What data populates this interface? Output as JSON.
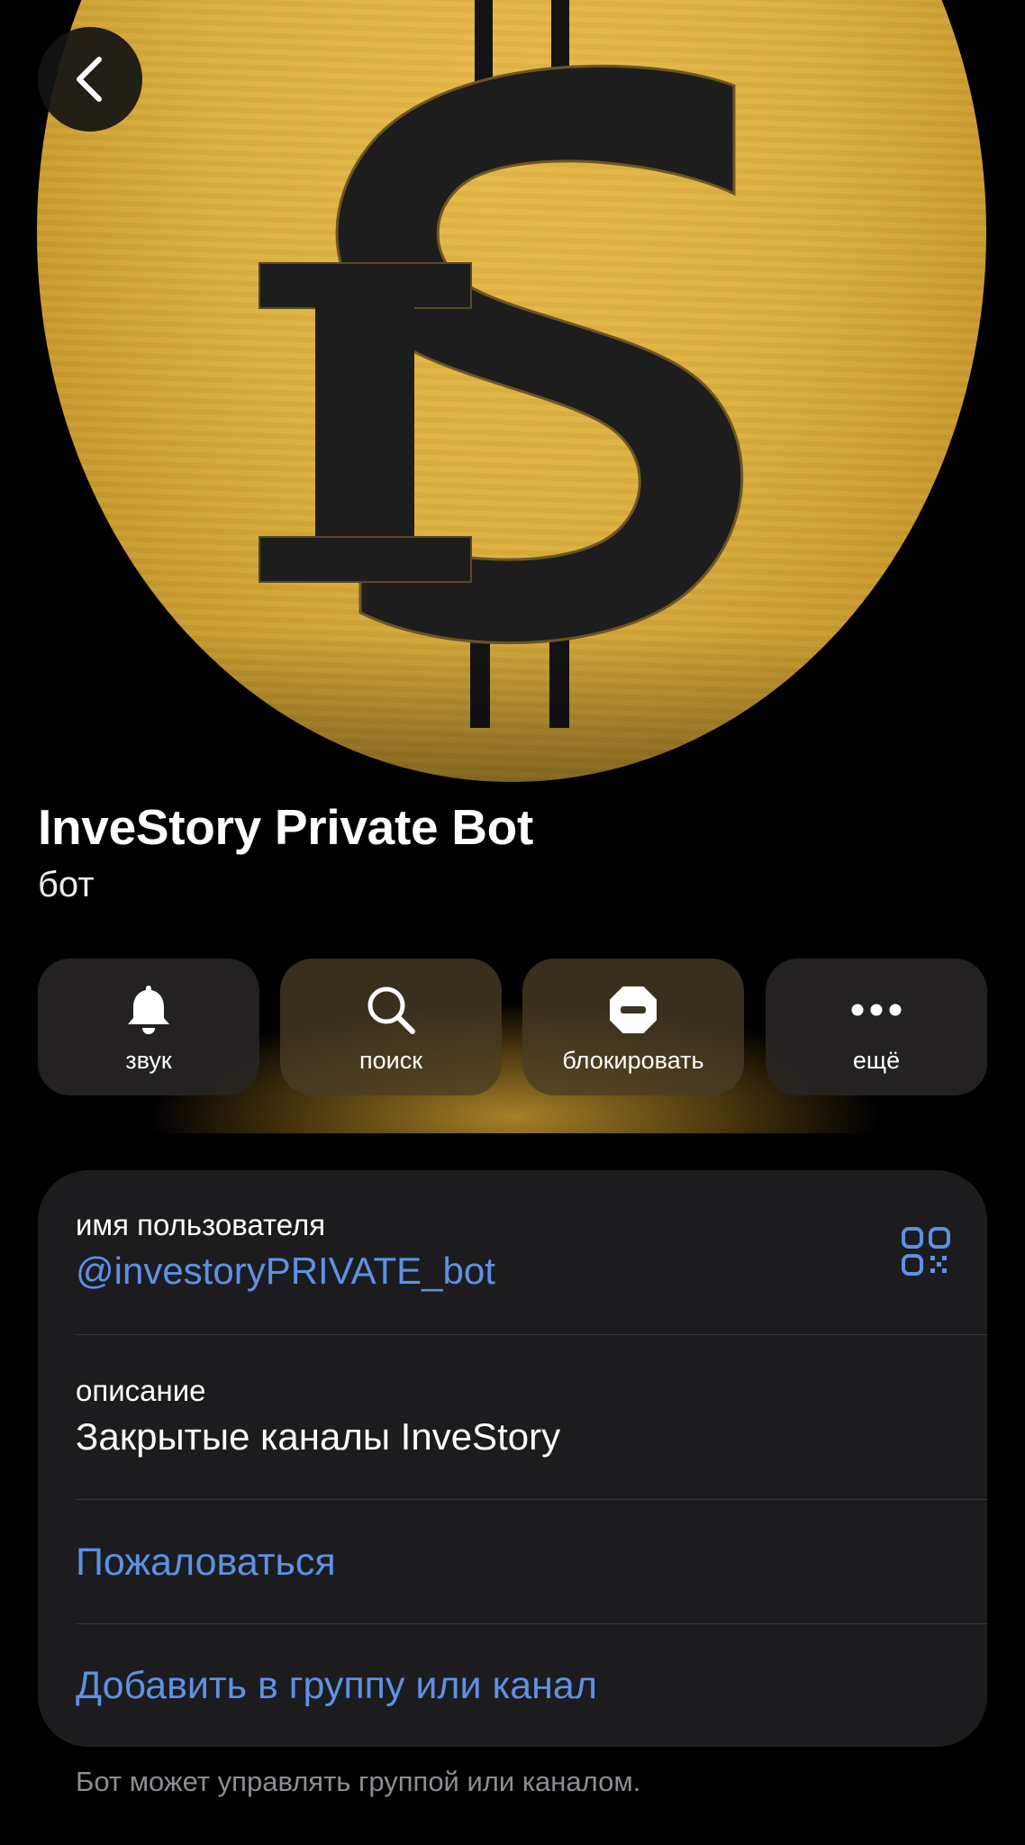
{
  "profile": {
    "name": "InveStory Private Bot",
    "status": "бот"
  },
  "actions": [
    {
      "label": "звук",
      "icon": "bell-icon"
    },
    {
      "label": "поиск",
      "icon": "search-icon"
    },
    {
      "label": "блокировать",
      "icon": "block-icon"
    },
    {
      "label": "ещё",
      "icon": "more-icon"
    }
  ],
  "info": {
    "username_caption": "имя пользователя",
    "username_value": "@investoryPRIVATE_bot",
    "description_caption": "описание",
    "description_value": "Закрытые каналы InveStory",
    "report_label": "Пожаловаться",
    "add_label": "Добавить в группу или канал"
  },
  "footer_note": "Бот может управлять группой или каналом.",
  "colors": {
    "background": "#000000",
    "card": "#1c1c1e",
    "link": "#5e90e6",
    "avatar_gold": "#ddb03f",
    "avatar_logo": "#1e1e1e",
    "secondary_text": "#8d8d93"
  }
}
